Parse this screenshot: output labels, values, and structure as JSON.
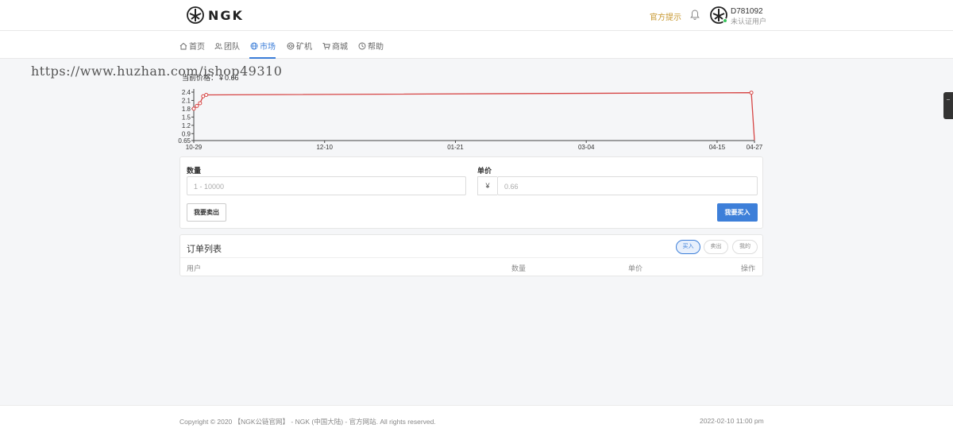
{
  "header": {
    "logo_text": "NGK",
    "notice_label": "官方提示",
    "user_id": "D781092",
    "user_status": "未认证用户"
  },
  "nav": {
    "items": [
      {
        "label": "首页",
        "icon": "home-icon"
      },
      {
        "label": "团队",
        "icon": "users-icon"
      },
      {
        "label": "市场",
        "icon": "globe-icon",
        "active": true
      },
      {
        "label": "矿机",
        "icon": "miner-icon"
      },
      {
        "label": "商城",
        "icon": "cart-icon"
      },
      {
        "label": "帮助",
        "icon": "help-icon"
      }
    ]
  },
  "watermark": "https://www.huzhan.com/ishop49310",
  "current_price_label": "当前价格：￥0.66",
  "chart_data": {
    "type": "line",
    "x_ticks": [
      "10-29",
      "12-10",
      "01-21",
      "03-04",
      "04-15",
      "04-27"
    ],
    "y_ticks": [
      "2.4",
      "2.1",
      "1.8",
      "1.5",
      "1.2",
      "0.9",
      "0.65"
    ],
    "ylim": [
      0.65,
      2.4
    ],
    "series": [
      {
        "color": "#d64545",
        "points": [
          {
            "x": "10-29",
            "y": 1.8
          },
          {
            "x": "10-30",
            "y": 1.9
          },
          {
            "x": "10-31",
            "y": 2.0
          },
          {
            "x": "11-01",
            "y": 2.25
          },
          {
            "x": "11-02",
            "y": 2.3
          },
          {
            "x": "04-26",
            "y": 2.38
          },
          {
            "x": "04-27",
            "y": 0.66
          }
        ]
      }
    ]
  },
  "trade_form": {
    "quantity_label": "数量",
    "quantity_placeholder": "1 - 10000",
    "price_label": "单价",
    "currency_symbol": "¥",
    "price_placeholder": "0.66",
    "sell_button": "我要卖出",
    "buy_button": "我要买入"
  },
  "orders": {
    "title": "订单列表",
    "filters": [
      "买入",
      "卖出",
      "我的"
    ],
    "active_filter": "买入",
    "columns": [
      "用户",
      "数量",
      "单价",
      "操作"
    ]
  },
  "footer": {
    "copyright": "Copyright © 2020 【NGK公链官网】 - NGK (中国大陆) - 官方网站. All rights reserved.",
    "timestamp": "2022-02-10 11:00 pm"
  }
}
